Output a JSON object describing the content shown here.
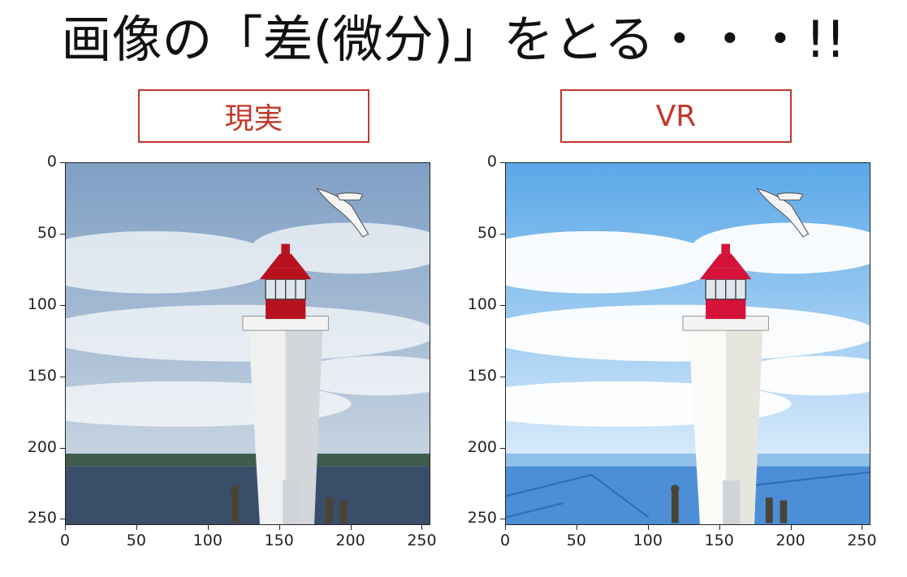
{
  "title": "画像の「差(微分)」をとる・・・!!",
  "panels": [
    {
      "label": "現実",
      "style": "photo",
      "yticks": [
        "0",
        "50",
        "100",
        "150",
        "200",
        "250"
      ],
      "xticks": [
        "0",
        "50",
        "100",
        "150",
        "200",
        "250"
      ],
      "colors": {
        "sky": "#7f9fc4",
        "sea": "#3a4e6a",
        "tower_red": "#b8121f"
      }
    },
    {
      "label": "VR",
      "style": "painted",
      "yticks": [
        "0",
        "50",
        "100",
        "150",
        "200",
        "250"
      ],
      "xticks": [
        "0",
        "50",
        "100",
        "150",
        "200",
        "250"
      ],
      "colors": {
        "sky": "#5aa8e8",
        "sea": "#4c8fd6",
        "tower_red": "#d4123a"
      }
    }
  ],
  "colors": {
    "label_border": "#c0392b",
    "label_text": "#c0392b"
  }
}
